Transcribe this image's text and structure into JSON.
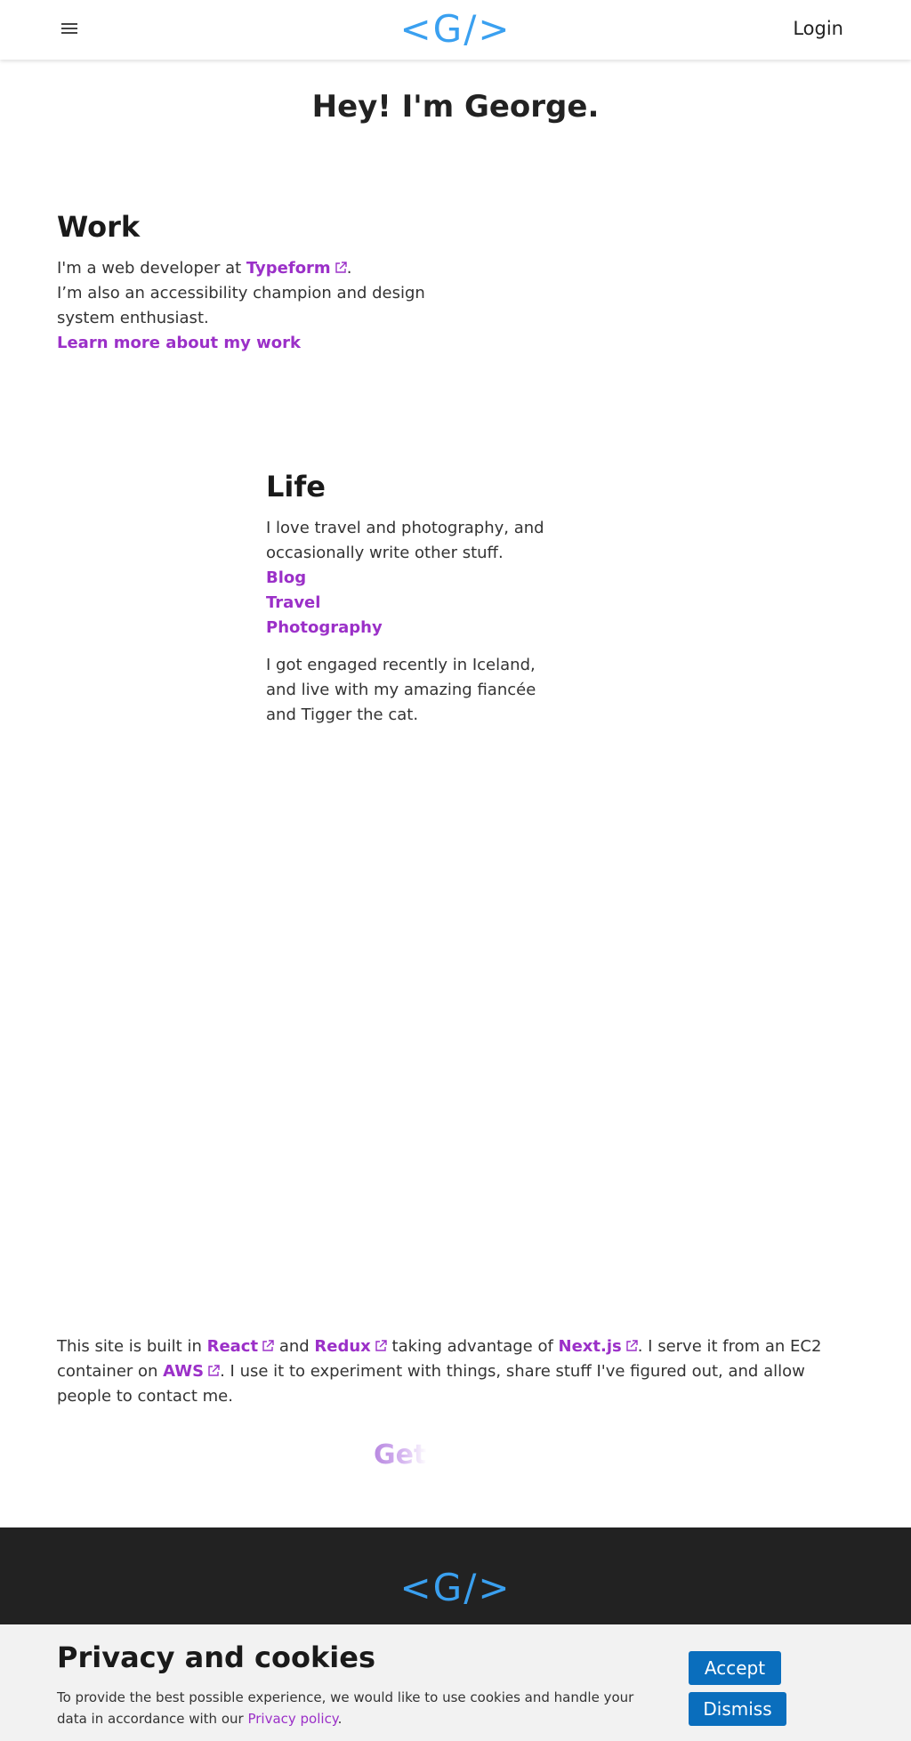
{
  "header": {
    "logo": "<G/>",
    "login": "Login"
  },
  "hero": {
    "title": "Hey! I'm George."
  },
  "work": {
    "title": "Work",
    "line1_prefix": "I'm a web developer at ",
    "company": "Typeform",
    "line1_suffix": ".",
    "line2": "I’m also an accessibility champion and design system enthusiast.",
    "learn_more": "Learn more about my work"
  },
  "life": {
    "title": "Life",
    "intro": "I love travel and photography, and occasionally write other stuff.",
    "links": [
      "Blog",
      "Travel",
      "Photography"
    ],
    "para2": "I got engaged recently in Iceland, and live with my amazing fiancée and Tigger the cat."
  },
  "built": {
    "t1": "This site is built in ",
    "react": "React",
    "t2": " and ",
    "redux": "Redux",
    "t3": " taking advantage of ",
    "next": "Next.js",
    "t4": ". I serve it from an EC2 container on ",
    "aws": "AWS",
    "t5": ". I use it to experiment with things, share stuff I've figured out, and allow people to contact me."
  },
  "get_in_touch": "Get i",
  "footer": {
    "logo": "<G/>"
  },
  "cookie": {
    "title": "Privacy and cookies",
    "text_prefix": "To provide the best possible experience, we would like to use cookies and handle your data in accordance with our ",
    "policy_link": "Privacy policy",
    "text_suffix": ".",
    "accept": "Accept",
    "dismiss": "Dismiss"
  },
  "colors": {
    "accent_link": "#9b30c8",
    "logo_blue": "#3aa0f0",
    "button_blue": "#0a6ebd",
    "footer_bg": "#222222",
    "cookie_bg": "#f2f2f2"
  },
  "icons": [
    "menu-icon",
    "external-link-icon"
  ]
}
